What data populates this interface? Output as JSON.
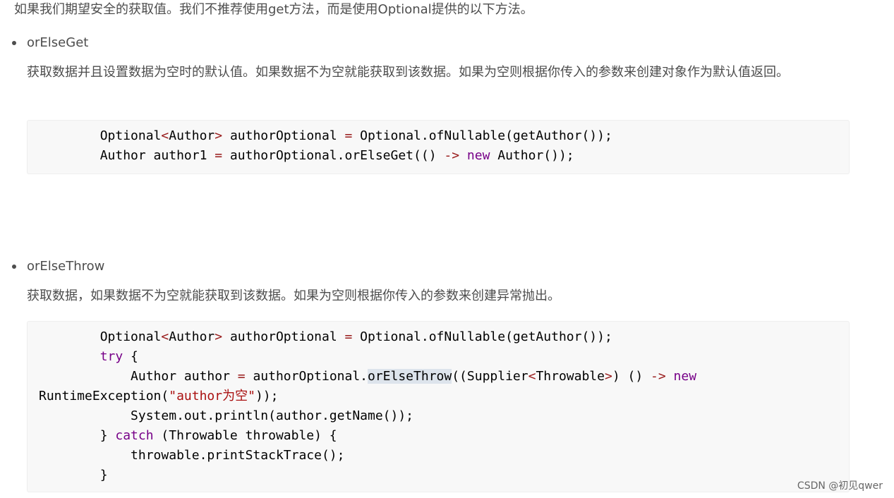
{
  "intro": "如果我们期望安全的获取值。我们不推荐使用get方法，而是使用Optional提供的以下方法。",
  "sections": [
    {
      "title": "orElseGet",
      "desc": "获取数据并且设置数据为空时的默认值。如果数据不为空就能获取到该数据。如果为空则根据你传入的参数来创建对象作为默认值返回。",
      "code": [
        [
          [
            "t",
            "        Optional"
          ],
          [
            "op",
            "<"
          ],
          [
            "t",
            "Author"
          ],
          [
            "op",
            ">"
          ],
          [
            "t",
            " authorOptional "
          ],
          [
            "op",
            "="
          ],
          [
            "t",
            " Optional.ofNullable(getAuthor());"
          ]
        ],
        [
          [
            "t",
            "        Author author1 "
          ],
          [
            "op",
            "="
          ],
          [
            "t",
            " authorOptional.orElseGet(() "
          ],
          [
            "op",
            "->"
          ],
          [
            "t",
            " "
          ],
          [
            "kw",
            "new"
          ],
          [
            "t",
            " Author());"
          ]
        ]
      ]
    },
    {
      "title": "orElseThrow",
      "desc": "获取数据，如果数据不为空就能获取到该数据。如果为空则根据你传入的参数来创建异常抛出。",
      "code": [
        [
          [
            "t",
            "        Optional"
          ],
          [
            "op",
            "<"
          ],
          [
            "t",
            "Author"
          ],
          [
            "op",
            ">"
          ],
          [
            "t",
            " authorOptional "
          ],
          [
            "op",
            "="
          ],
          [
            "t",
            " Optional.ofNullable(getAuthor());"
          ]
        ],
        [
          [
            "t",
            "        "
          ],
          [
            "kw",
            "try"
          ],
          [
            "t",
            " {"
          ]
        ],
        [
          [
            "t",
            "            Author author "
          ],
          [
            "op",
            "="
          ],
          [
            "t",
            " authorOptional."
          ],
          [
            "sel",
            "orElseThrow"
          ],
          [
            "t",
            "((Supplier"
          ],
          [
            "op",
            "<"
          ],
          [
            "t",
            "Throwable"
          ],
          [
            "op",
            ">"
          ],
          [
            "t",
            ") () "
          ],
          [
            "op",
            "->"
          ],
          [
            "t",
            " "
          ],
          [
            "kw",
            "new"
          ]
        ],
        [
          [
            "t",
            "RuntimeException("
          ],
          [
            "str",
            "\"author为空\""
          ],
          [
            "t",
            "));"
          ]
        ],
        [
          [
            "t",
            "            System.out.println(author.getName());"
          ]
        ],
        [
          [
            "t",
            "        } "
          ],
          [
            "kw",
            "catch"
          ],
          [
            "t",
            " (Throwable throwable) {"
          ]
        ],
        [
          [
            "t",
            "            throwable.printStackTrace();"
          ]
        ],
        [
          [
            "t",
            "        }"
          ]
        ]
      ]
    }
  ],
  "watermark": "CSDN @初见qwer"
}
